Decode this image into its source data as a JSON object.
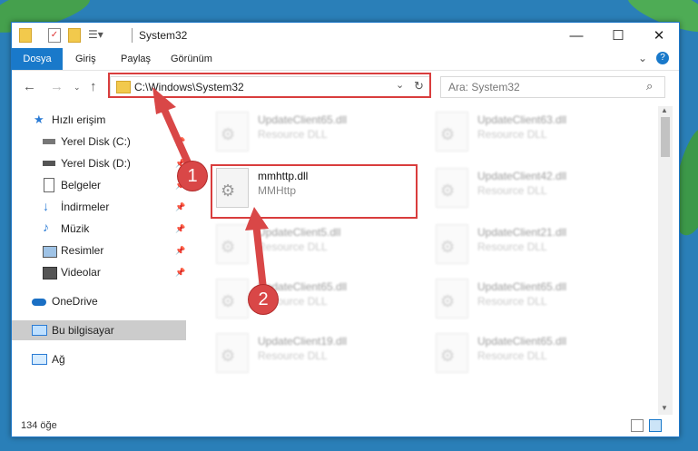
{
  "window": {
    "title": "System32"
  },
  "ribbon": {
    "tabs": [
      "Dosya",
      "Giriş",
      "Paylaş",
      "Görünüm"
    ]
  },
  "address": {
    "path": "C:\\Windows\\System32"
  },
  "search": {
    "placeholder": "Ara: System32"
  },
  "sidebar": {
    "items": [
      {
        "label": "Hızlı erişim",
        "icon": "star-icon"
      },
      {
        "label": "Yerel Disk (C:)",
        "icon": "drive-icon"
      },
      {
        "label": "Yerel Disk (D:)",
        "icon": "drive-icon"
      },
      {
        "label": "Belgeler",
        "icon": "document-icon"
      },
      {
        "label": "İndirmeler",
        "icon": "download-icon"
      },
      {
        "label": "Müzik",
        "icon": "music-icon"
      },
      {
        "label": "Resimler",
        "icon": "pictures-icon"
      },
      {
        "label": "Videolar",
        "icon": "video-icon"
      },
      {
        "label": "OneDrive",
        "icon": "cloud-icon"
      },
      {
        "label": "Bu bilgisayar",
        "icon": "computer-icon"
      },
      {
        "label": "Ağ",
        "icon": "network-icon"
      }
    ]
  },
  "files": {
    "selected": {
      "name": "mmhttp.dll",
      "desc": "MMHttp"
    },
    "left": [
      {
        "name": "UpdateClient65.dll",
        "desc": "Resource DLL"
      },
      {
        "name": "UpdateClient5.dll",
        "desc": "Resource DLL"
      },
      {
        "name": "UpdateClient65.dll",
        "desc": "Resource DLL"
      },
      {
        "name": "UpdateClient19.dll",
        "desc": "Resource DLL"
      }
    ],
    "right": [
      {
        "name": "UpdateClient63.dll",
        "desc": "Resource DLL"
      },
      {
        "name": "UpdateClient42.dll",
        "desc": "Resource DLL"
      },
      {
        "name": "UpdateClient21.dll",
        "desc": "Resource DLL"
      },
      {
        "name": "UpdateClient65.dll",
        "desc": "Resource DLL"
      },
      {
        "name": "UpdateClient65.dll",
        "desc": "Resource DLL"
      }
    ]
  },
  "status": {
    "count": "134 öğe"
  },
  "markers": {
    "one": "1",
    "two": "2"
  },
  "colors": {
    "accent": "#1979ca",
    "highlight": "#d93d3d"
  }
}
